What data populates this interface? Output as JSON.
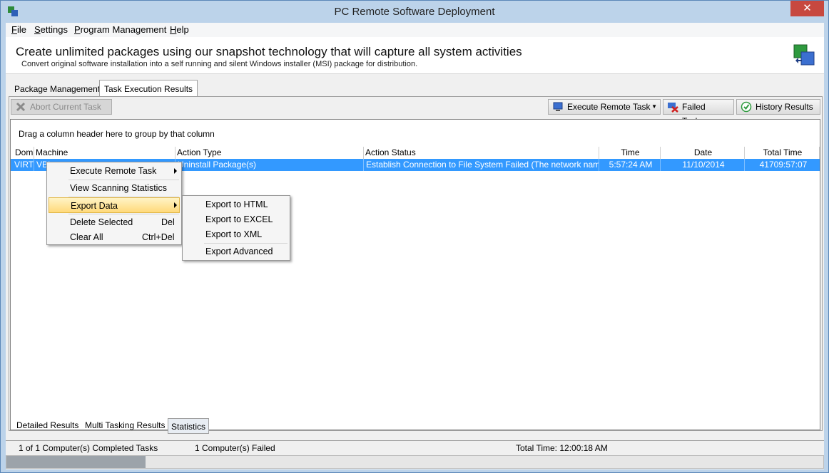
{
  "window": {
    "title": "PC Remote Software Deployment",
    "close_glyph": "✕"
  },
  "menu": [
    {
      "label": "File",
      "mnemonic": "F",
      "rest": "ile"
    },
    {
      "label": "Settings",
      "mnemonic": "S",
      "rest": "ettings"
    },
    {
      "label": "Program Management",
      "mnemonic": "P",
      "rest": "rogram Management"
    },
    {
      "label": "Help",
      "mnemonic": "H",
      "rest": "elp"
    }
  ],
  "banner": {
    "title": "Create unlimited packages using our snapshot technology that will capture all system activities",
    "subtitle": "Convert original software installation into a self running and silent Windows installer (MSI) package for distribution."
  },
  "top_tabs": [
    "Package Management",
    "Task Execution Results"
  ],
  "toolbar": {
    "abort": "Abort Current Task",
    "execute": "Execute Remote Task",
    "failed": "Failed Tasks",
    "history": "History Results"
  },
  "grid": {
    "group_hint": "Drag a column header here to group by that column",
    "columns": [
      "Domain",
      "Machine",
      "Action Type",
      "Action Status",
      "Time",
      "Date",
      "Total Time"
    ],
    "row": {
      "domain": "VIRT",
      "machine": "VBI",
      "action_type": "Uninstall Package(s)",
      "action_status": "Establish Connection to File System Failed (The network name cannot be found)",
      "time": "5:57:24 AM",
      "date": "11/10/2014",
      "total_time": "41709:57:07"
    }
  },
  "context_menu": {
    "items": [
      {
        "label": "Execute Remote Task",
        "shortcut": ""
      },
      {
        "label": "View Scanning Statistics",
        "shortcut": ""
      },
      {
        "label": "Export Data",
        "shortcut": ""
      },
      {
        "label": "Delete Selected",
        "shortcut": "Del"
      },
      {
        "label": "Clear All",
        "shortcut": "Ctrl+Del"
      }
    ]
  },
  "submenu": {
    "items": [
      "Export to HTML",
      "Export to EXCEL",
      "Export to XML",
      "Export Advanced"
    ]
  },
  "bottom_tabs": [
    "Detailed Results",
    "Multi Tasking Results",
    "Statistics"
  ],
  "status": {
    "completed": "1 of 1 Computer(s) Completed Tasks",
    "failed": "1 Computer(s) Failed",
    "total_time": "Total Time: 12:00:18 AM",
    "progress": 0.17
  },
  "colors": {
    "selection": "#3399ff",
    "close": "#c7483f",
    "menu_highlight": "#ffd97a"
  }
}
